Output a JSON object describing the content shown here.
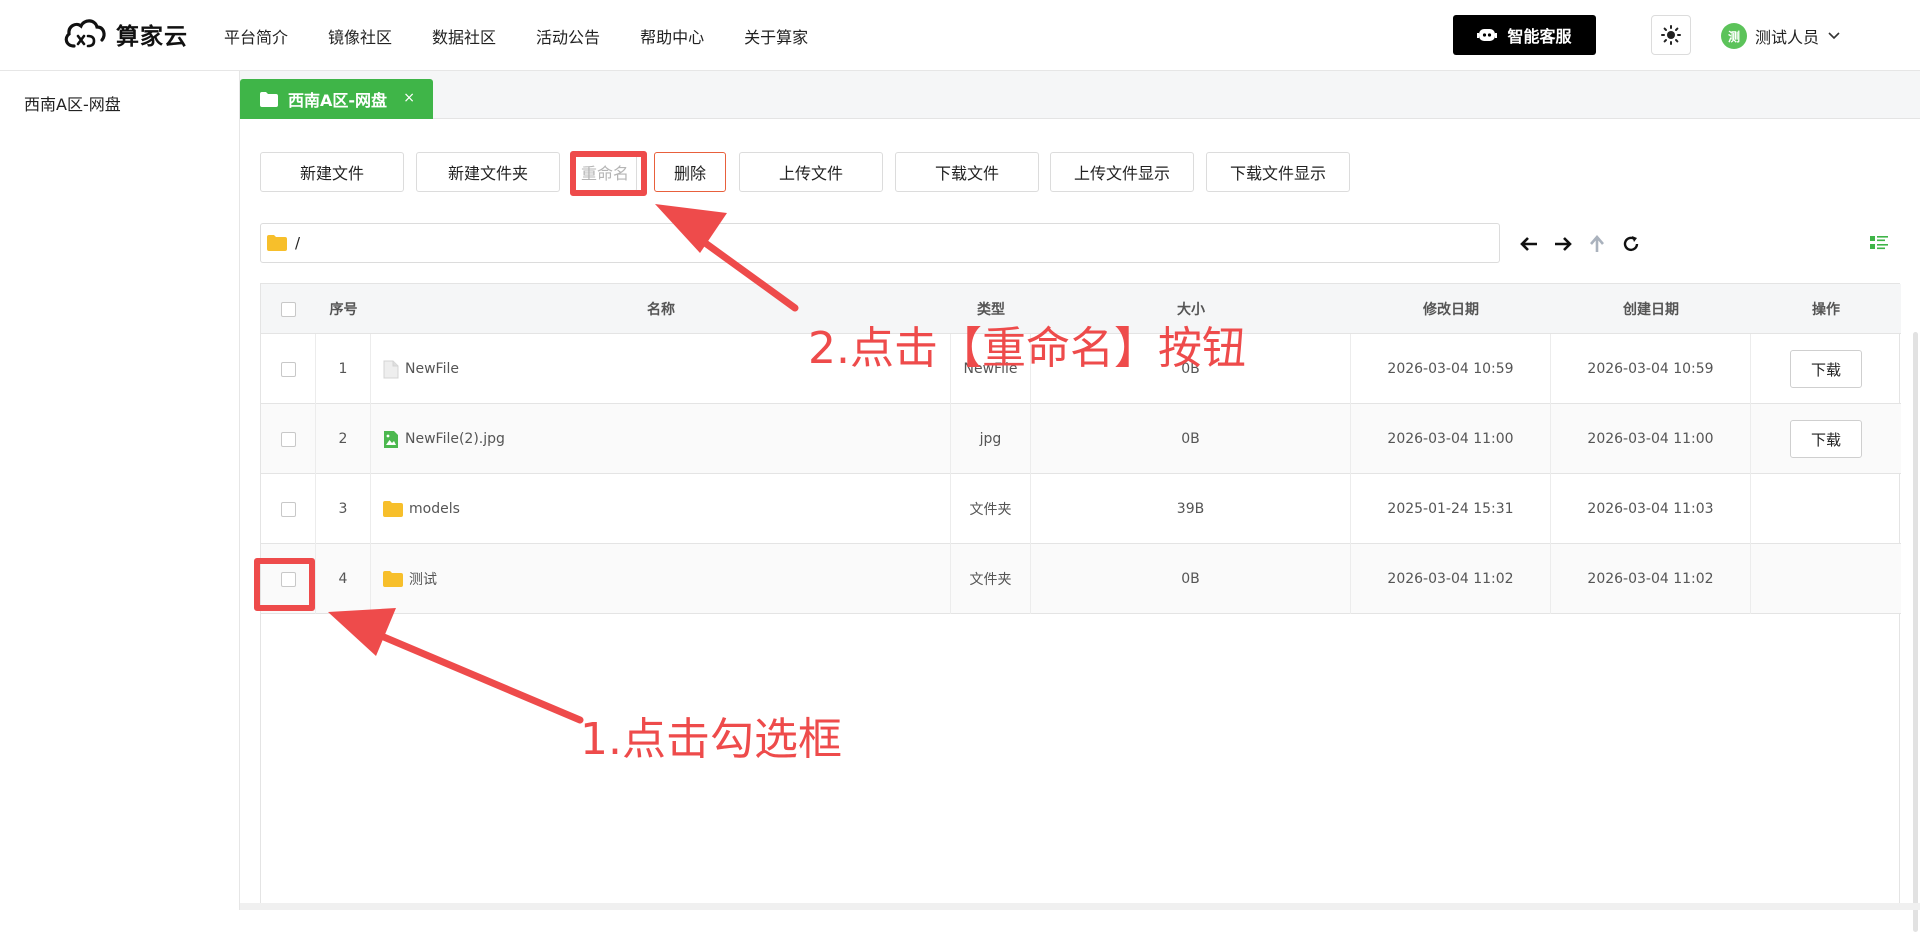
{
  "header": {
    "logo_text": "算家云",
    "nav": [
      "平台简介",
      "镜像社区",
      "数据社区",
      "活动公告",
      "帮助中心",
      "关于算家"
    ],
    "support_label": "智能客服",
    "user_initial": "测",
    "user_name": "测试人员"
  },
  "sidebar": {
    "items": [
      "西南A区-网盘"
    ]
  },
  "tabs": [
    {
      "label": "西南A区-网盘",
      "close": "×"
    }
  ],
  "toolbar": {
    "new_file": "新建文件",
    "new_folder": "新建文件夹",
    "rename": "重命名",
    "delete": "删除",
    "upload": "上传文件",
    "download": "下载文件",
    "show_upload": "上传文件显示",
    "show_download": "下载文件显示"
  },
  "path": "/",
  "table": {
    "headers": [
      "序号",
      "名称",
      "类型",
      "大小",
      "修改日期",
      "创建日期",
      "操作"
    ],
    "rows": [
      {
        "index": "1",
        "name": "NewFile",
        "icon": "file-icon",
        "type": "NewFile",
        "size": "0B",
        "modified": "2026-03-04 10:59",
        "created": "2026-03-04 10:59",
        "action": "下载"
      },
      {
        "index": "2",
        "name": "NewFile(2).jpg",
        "icon": "image-icon",
        "type": "jpg",
        "size": "0B",
        "modified": "2026-03-04 11:00",
        "created": "2026-03-04 11:00",
        "action": "下载"
      },
      {
        "index": "3",
        "name": "models",
        "icon": "folder-icon",
        "type": "文件夹",
        "size": "39B",
        "modified": "2025-01-24 15:31",
        "created": "2026-03-04 11:03",
        "action": ""
      },
      {
        "index": "4",
        "name": "测试",
        "icon": "folder-icon",
        "type": "文件夹",
        "size": "0B",
        "modified": "2026-03-04 11:02",
        "created": "2026-03-04 11:02",
        "action": ""
      }
    ]
  },
  "annotations": {
    "step1": "1.点击勾选框",
    "step2": "2.点击【重命名】按钮"
  },
  "colors": {
    "accent": "#3fb548",
    "annotation": "#ee4b4b",
    "danger_border": "#e8603c"
  }
}
